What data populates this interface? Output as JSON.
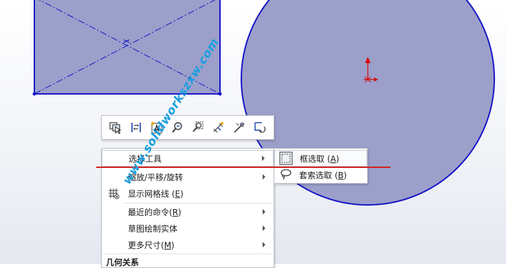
{
  "colors": {
    "sketch_fill": "#9b9fca",
    "sketch_line": "#1414c8",
    "origin_red": "#dd0000",
    "annotation_red": "#d21e1e",
    "watermark": "#1a9fe0"
  },
  "toolbar": {
    "icons": [
      "select-other-icon",
      "display-delete-relations-icon",
      "sketch-text-icon",
      "zoom-to-selection-icon",
      "zoom-to-area-icon",
      "smart-dimension-icon",
      "sketch-tool-icon",
      "undo-sketch-icon"
    ]
  },
  "menu": {
    "items": [
      {
        "label": "选择工具",
        "has_submenu": true
      },
      {
        "label": "缩放/平移/旋转",
        "has_submenu": true
      },
      {
        "label": "显示网格线 (",
        "shortcut": "E",
        "suffix": ")",
        "has_submenu": false
      },
      {
        "label": "最近的命令(",
        "shortcut": "R",
        "suffix": ")",
        "has_submenu": true
      },
      {
        "label": "草图绘制实体",
        "has_submenu": true
      },
      {
        "label": "更多尺寸(",
        "shortcut": "M",
        "suffix": ")",
        "has_submenu": true
      }
    ],
    "section_header": "几何关系"
  },
  "submenu": {
    "items": [
      {
        "label": "框选取 (",
        "shortcut": "A",
        "suffix": ")"
      },
      {
        "label": "套索选取 (",
        "shortcut": "B",
        "suffix": ")"
      }
    ]
  },
  "watermark": "www.solidworkszxw.com"
}
